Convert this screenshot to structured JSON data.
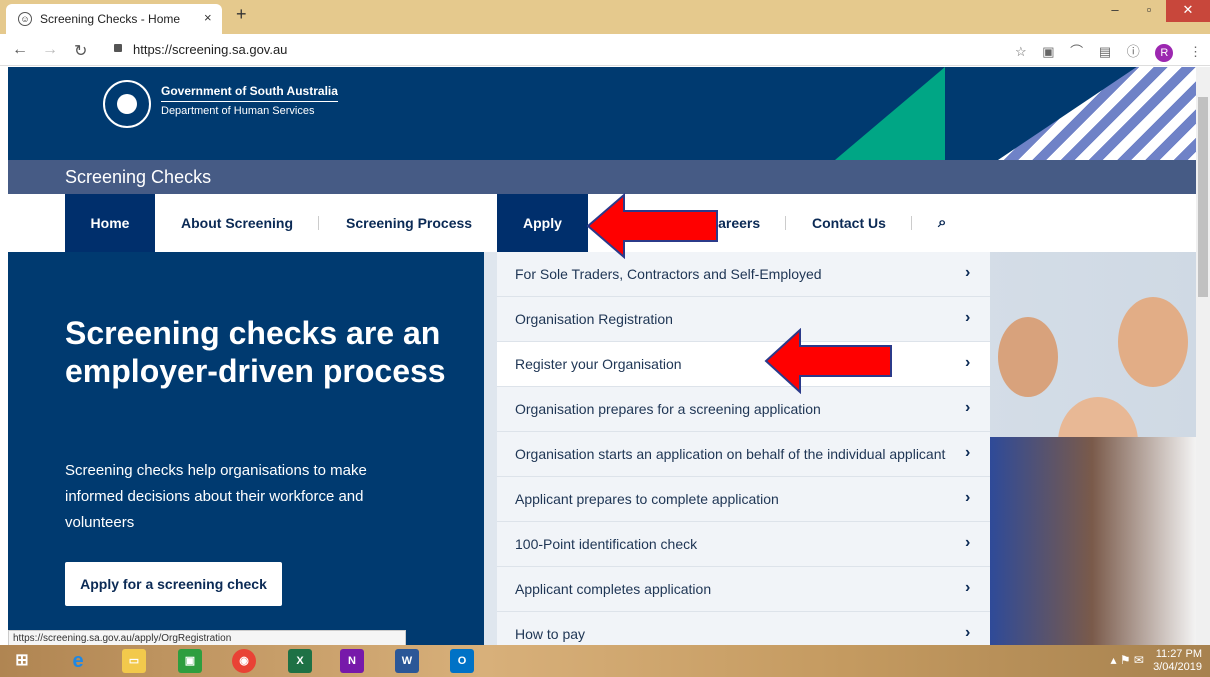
{
  "browser": {
    "tab_title": "Screening Checks - Home",
    "url": "https://screening.sa.gov.au",
    "status_url": "https://screening.sa.gov.au/apply/OrgRegistration",
    "avatar_letter": "R"
  },
  "header": {
    "gov_name": "Government of South Australia",
    "dept_name": "Department of Human Services",
    "site_title": "Screening Checks"
  },
  "nav": {
    "home": "Home",
    "about": "About Screening",
    "process": "Screening Process",
    "apply": "Apply",
    "careers": "Careers",
    "contact": "Contact Us"
  },
  "hero": {
    "heading": "Screening checks are an employer-driven process",
    "text": "Screening checks help organisations to make informed decisions about their workforce and volunteers",
    "button": "Apply for a screening check"
  },
  "menu": {
    "items": [
      "For Sole Traders, Contractors and Self-Employed",
      "Organisation Registration",
      "Register your Organisation",
      "Organisation prepares for a screening application",
      "Organisation starts an application on behalf of the individual applicant",
      "Applicant prepares to complete application",
      "100-Point identification check",
      "Applicant completes application",
      "How to pay"
    ]
  },
  "taskbar": {
    "time": "11:27 PM",
    "date": "3/04/2019"
  },
  "colors": {
    "navy": "#003a70",
    "title_bar": "#465b85",
    "arrow_red": "#ff0000"
  }
}
